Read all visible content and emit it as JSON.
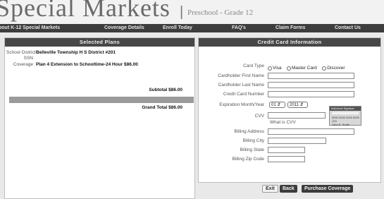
{
  "header": {
    "brand": "Special Markets",
    "divider": "|",
    "subtitle": "Preschool - Grade 12"
  },
  "nav": [
    {
      "label": "bout K-12 Special Markets"
    },
    {
      "label": "Coverage Details"
    },
    {
      "label": "Enroll Today"
    },
    {
      "label": "FAQ's"
    },
    {
      "label": "Claim Forms"
    },
    {
      "label": "Contact Us"
    }
  ],
  "selected_plans": {
    "title": "Selected Plans",
    "school_label": "School District",
    "ssn_label": "SSN",
    "school_value": "Belleville Township H S District #201",
    "coverage_label": "Coverage",
    "coverage_value": "Plan 4 Extension to Schooltime-24 Hour $86.00",
    "subtotal": "Subtotal $86.00",
    "grand_total": "Grand Total $86.00"
  },
  "credit_card": {
    "title": "Credit Card Information",
    "card_type_label": "Card Type",
    "card_options": [
      "Visa",
      "Master Card",
      "Discover"
    ],
    "first_name_label": "Cardholder First Name",
    "last_name_label": "Cardholder Last Name",
    "card_number_label": "Credit Card Number",
    "expiration_label": "Expiration Month/Year",
    "month_value": "01",
    "year_value": "2011",
    "cvv_label": "CVV",
    "what_is_cvv": "What is CVV",
    "billing_address_label": "Billing Address",
    "billing_city_label": "Billing City",
    "billing_state_label": "Billing State",
    "billing_zip_label": "Billing Zip Code",
    "card_image_text": [
      "Authorized Signature",
      "0000 0000 0000 0000 123",
      "John E. Smith"
    ]
  },
  "buttons": {
    "exit": "Exit",
    "back": "Back",
    "purchase": "Purchase Coverage"
  }
}
